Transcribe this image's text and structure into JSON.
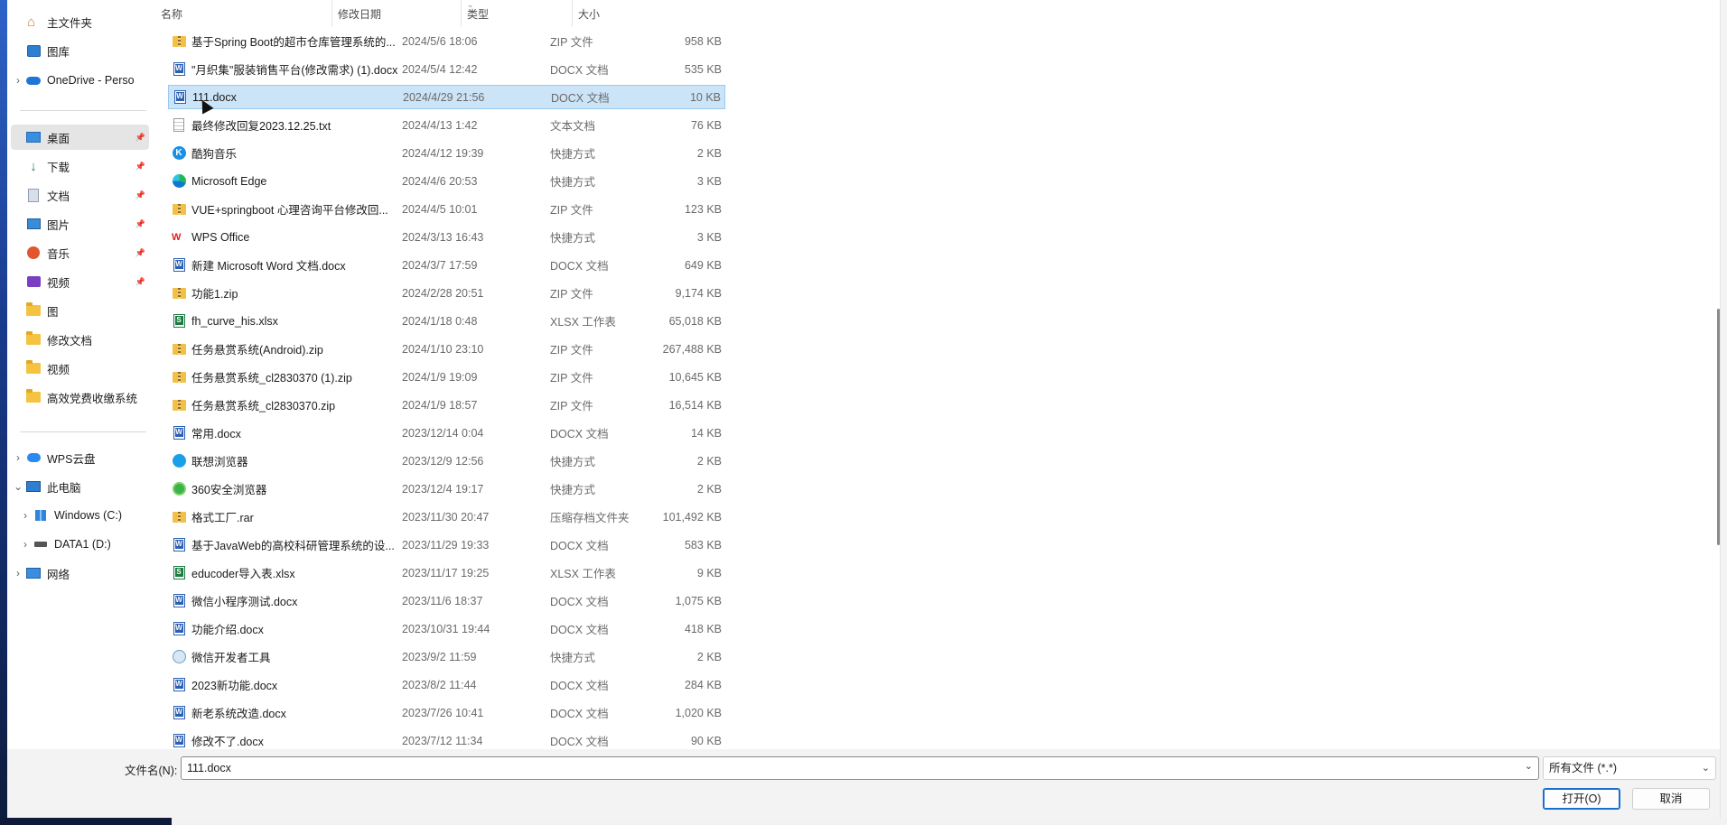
{
  "nav": {
    "items": [
      {
        "label": "主文件夹",
        "icon": "home-icon",
        "chevron": "",
        "pinned": false
      },
      {
        "label": "图库",
        "icon": "gallery-icon",
        "chevron": "",
        "pinned": false
      },
      {
        "label": "OneDrive - Perso",
        "icon": "onedrive-icon",
        "chevron": "›",
        "pinned": false
      },
      {
        "label": "桌面",
        "icon": "desktop-icon",
        "chevron": "",
        "pinned": true,
        "selected": true
      },
      {
        "label": "下载",
        "icon": "download-icon",
        "chevron": "",
        "pinned": true
      },
      {
        "label": "文档",
        "icon": "documents-icon",
        "chevron": "",
        "pinned": true
      },
      {
        "label": "图片",
        "icon": "pictures-icon",
        "chevron": "",
        "pinned": true
      },
      {
        "label": "音乐",
        "icon": "music-icon",
        "chevron": "",
        "pinned": true
      },
      {
        "label": "视频",
        "icon": "videos-icon",
        "chevron": "",
        "pinned": true
      },
      {
        "label": "图",
        "icon": "folder-icon",
        "chevron": "",
        "pinned": false
      },
      {
        "label": "修改文档",
        "icon": "folder-icon",
        "chevron": "",
        "pinned": false
      },
      {
        "label": "视频",
        "icon": "folder-icon",
        "chevron": "",
        "pinned": false
      },
      {
        "label": "高效党费收缴系统",
        "icon": "folder-icon",
        "chevron": "",
        "pinned": false
      },
      {
        "label": "WPS云盘",
        "icon": "wps-cloud-icon",
        "chevron": "›",
        "pinned": false
      },
      {
        "label": "此电脑",
        "icon": "this-pc-icon",
        "chevron": "⌄",
        "pinned": false
      },
      {
        "label": "Windows (C:)",
        "icon": "windows-drive-icon",
        "chevron": "›",
        "pinned": false
      },
      {
        "label": "DATA1 (D:)",
        "icon": "drive-icon",
        "chevron": "›",
        "pinned": false
      },
      {
        "label": "网络",
        "icon": "network-icon",
        "chevron": "›",
        "pinned": false
      }
    ]
  },
  "columns": {
    "name": "名称",
    "date": "修改日期",
    "type": "类型",
    "size": "大小"
  },
  "files": [
    {
      "name": "基于Spring Boot的超市仓库管理系统的...",
      "date": "2024/5/6 18:06",
      "type": "ZIP 文件",
      "size": "958 KB",
      "icon": "zip"
    },
    {
      "name": "\"月织集\"服装销售平台(修改需求) (1).docx",
      "date": "2024/5/4 12:42",
      "type": "DOCX 文档",
      "size": "535 KB",
      "icon": "docx"
    },
    {
      "name": "111.docx",
      "date": "2024/4/29 21:56",
      "type": "DOCX 文档",
      "size": "10 KB",
      "icon": "docx",
      "selected": true
    },
    {
      "name": "最终修改回复2023.12.25.txt",
      "date": "2024/4/13 1:42",
      "type": "文本文档",
      "size": "76 KB",
      "icon": "txt"
    },
    {
      "name": "酷狗音乐",
      "date": "2024/4/12 19:39",
      "type": "快捷方式",
      "size": "2 KB",
      "icon": "kugou"
    },
    {
      "name": "Microsoft Edge",
      "date": "2024/4/6 20:53",
      "type": "快捷方式",
      "size": "3 KB",
      "icon": "edge"
    },
    {
      "name": "VUE+springboot 心理咨询平台修改回...",
      "date": "2024/4/5 10:01",
      "type": "ZIP 文件",
      "size": "123 KB",
      "icon": "zip"
    },
    {
      "name": "WPS Office",
      "date": "2024/3/13 16:43",
      "type": "快捷方式",
      "size": "3 KB",
      "icon": "wps"
    },
    {
      "name": "新建 Microsoft Word 文档.docx",
      "date": "2024/3/7 17:59",
      "type": "DOCX 文档",
      "size": "649 KB",
      "icon": "docx"
    },
    {
      "name": "功能1.zip",
      "date": "2024/2/28 20:51",
      "type": "ZIP 文件",
      "size": "9,174 KB",
      "icon": "zip"
    },
    {
      "name": "fh_curve_his.xlsx",
      "date": "2024/1/18 0:48",
      "type": "XLSX 工作表",
      "size": "65,018 KB",
      "icon": "xlsx"
    },
    {
      "name": "任务悬赏系统(Android).zip",
      "date": "2024/1/10 23:10",
      "type": "ZIP 文件",
      "size": "267,488 KB",
      "icon": "zip"
    },
    {
      "name": "任务悬赏系统_cl2830370 (1).zip",
      "date": "2024/1/9 19:09",
      "type": "ZIP 文件",
      "size": "10,645 KB",
      "icon": "zip"
    },
    {
      "name": "任务悬赏系统_cl2830370.zip",
      "date": "2024/1/9 18:57",
      "type": "ZIP 文件",
      "size": "16,514 KB",
      "icon": "zip"
    },
    {
      "name": "常用.docx",
      "date": "2023/12/14 0:04",
      "type": "DOCX 文档",
      "size": "14 KB",
      "icon": "docx"
    },
    {
      "name": "联想浏览器",
      "date": "2023/12/9 12:56",
      "type": "快捷方式",
      "size": "2 KB",
      "icon": "lenovo"
    },
    {
      "name": "360安全浏览器",
      "date": "2023/12/4 19:17",
      "type": "快捷方式",
      "size": "2 KB",
      "icon": "360"
    },
    {
      "name": "格式工厂.rar",
      "date": "2023/11/30 20:47",
      "type": "压缩存档文件夹",
      "size": "101,492 KB",
      "icon": "zip"
    },
    {
      "name": "基于JavaWeb的高校科研管理系统的设...",
      "date": "2023/11/29 19:33",
      "type": "DOCX 文档",
      "size": "583 KB",
      "icon": "docx"
    },
    {
      "name": "educoder导入表.xlsx",
      "date": "2023/11/17 19:25",
      "type": "XLSX 工作表",
      "size": "9 KB",
      "icon": "xlsx"
    },
    {
      "name": "微信小程序测试.docx",
      "date": "2023/11/6 18:37",
      "type": "DOCX 文档",
      "size": "1,075 KB",
      "icon": "docx"
    },
    {
      "name": "功能介绍.docx",
      "date": "2023/10/31 19:44",
      "type": "DOCX 文档",
      "size": "418 KB",
      "icon": "docx"
    },
    {
      "name": "微信开发者工具",
      "date": "2023/9/2 11:59",
      "type": "快捷方式",
      "size": "2 KB",
      "icon": "wx"
    },
    {
      "name": "2023新功能.docx",
      "date": "2023/8/2 11:44",
      "type": "DOCX 文档",
      "size": "284 KB",
      "icon": "docx"
    },
    {
      "name": "新老系统改造.docx",
      "date": "2023/7/26 10:41",
      "type": "DOCX 文档",
      "size": "1,020 KB",
      "icon": "docx"
    },
    {
      "name": "修改不了.docx",
      "date": "2023/7/12 11:34",
      "type": "DOCX 文档",
      "size": "90 KB",
      "icon": "docx"
    }
  ],
  "footer": {
    "filename_label": "文件名(N):",
    "filename_value": "111.docx",
    "filetype_value": "所有文件 (*.*)",
    "open_label": "打开(O)",
    "cancel_label": "取消"
  },
  "colors": {
    "selection": "#cce4f7",
    "accent": "#1a6fcd"
  }
}
